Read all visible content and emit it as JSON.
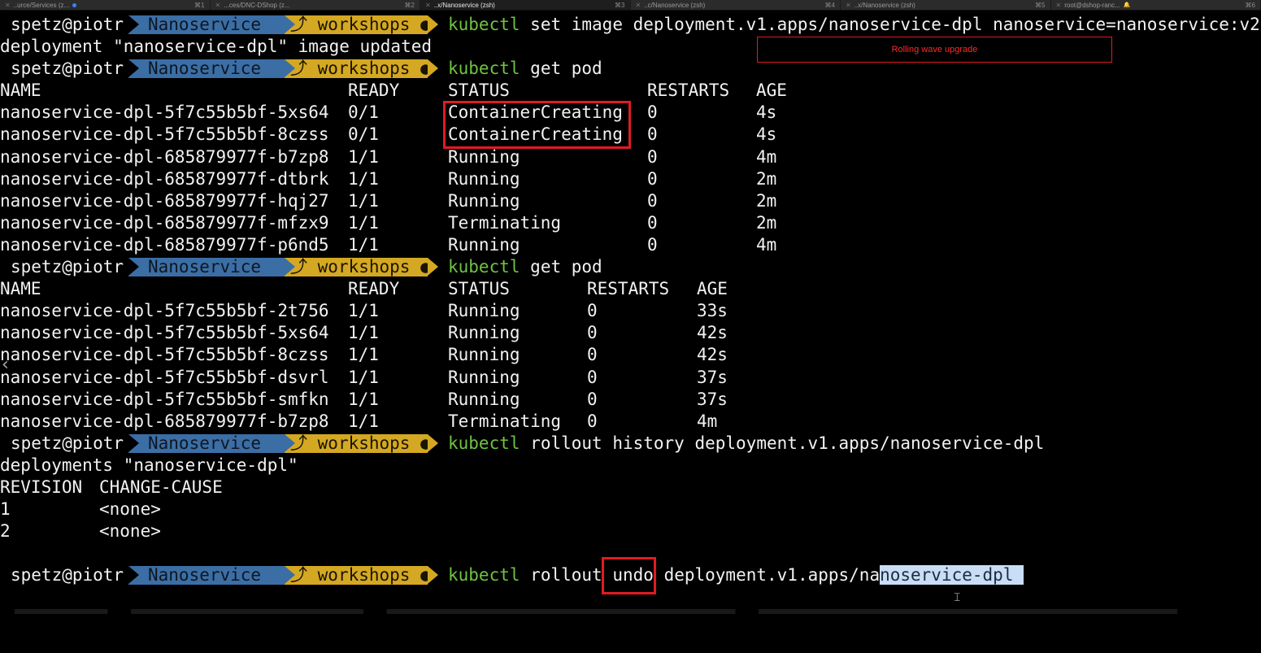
{
  "tabs": [
    {
      "label": "..urce/Services (z...",
      "shortcut": "⌘1",
      "dot": true,
      "active": false
    },
    {
      "label": "...ces/DNC-DShop (z...",
      "shortcut": "⌘2",
      "active": false
    },
    {
      "label": "..x/Nanoservice (zsh)",
      "shortcut": "⌘3",
      "active": true
    },
    {
      "label": "..c/Nanoservice (zsh)",
      "shortcut": "⌘4",
      "active": false
    },
    {
      "label": "..x/Nanoservice (zsh)",
      "shortcut": "⌘5",
      "active": false
    },
    {
      "label": "root@dshop-ranc...",
      "shortcut": "⌘6",
      "bell": true,
      "active": false
    }
  ],
  "prompt": {
    "user": "spetz@piotr",
    "dir": "Nanoservice",
    "branch_icon": "branch-icon",
    "branch_symbol": "⤴",
    "branch": "workshops",
    "dirty_marker": "●"
  },
  "commands": {
    "c1_kw": "kubectl",
    "c1_rest": "set image deployment.v1.apps/nanoservice-dpl nanoservice=nanoservice:v2",
    "c1_output": "deployment \"nanoservice-dpl\" image updated",
    "c2_kw": "kubectl",
    "c2_rest": "get pod",
    "c3_kw": "kubectl",
    "c3_rest": "get pod",
    "c4_kw": "kubectl",
    "c4_rest": "rollout history deployment.v1.apps/nanoservice-dpl",
    "c4_output": "deployments \"nanoservice-dpl\"",
    "c5_kw": "kubectl",
    "c5_a": "rollout",
    "c5_undo": "undo",
    "c5_b": "deployment.v1.apps/na",
    "c5_sel": "noservice-dpl "
  },
  "table1": {
    "headers": [
      "NAME",
      "READY",
      "STATUS",
      "RESTARTS",
      "AGE"
    ],
    "rows": [
      [
        "nanoservice-dpl-5f7c55b5bf-5xs64",
        "0/1",
        "ContainerCreating",
        "0",
        "4s"
      ],
      [
        "nanoservice-dpl-5f7c55b5bf-8czss",
        "0/1",
        "ContainerCreating",
        "0",
        "4s"
      ],
      [
        "nanoservice-dpl-685879977f-b7zp8",
        "1/1",
        "Running",
        "0",
        "4m"
      ],
      [
        "nanoservice-dpl-685879977f-dtbrk",
        "1/1",
        "Running",
        "0",
        "2m"
      ],
      [
        "nanoservice-dpl-685879977f-hqj27",
        "1/1",
        "Running",
        "0",
        "2m"
      ],
      [
        "nanoservice-dpl-685879977f-mfzx9",
        "1/1",
        "Terminating",
        "0",
        "2m"
      ],
      [
        "nanoservice-dpl-685879977f-p6nd5",
        "1/1",
        "Running",
        "0",
        "4m"
      ]
    ]
  },
  "table2": {
    "headers": [
      "NAME",
      "READY",
      "STATUS",
      "RESTARTS",
      "AGE"
    ],
    "rows": [
      [
        "nanoservice-dpl-5f7c55b5bf-2t756",
        "1/1",
        "Running",
        "0",
        "33s"
      ],
      [
        "nanoservice-dpl-5f7c55b5bf-5xs64",
        "1/1",
        "Running",
        "0",
        "42s"
      ],
      [
        "nanoservice-dpl-5f7c55b5bf-8czss",
        "1/1",
        "Running",
        "0",
        "42s"
      ],
      [
        "nanoservice-dpl-5f7c55b5bf-dsvrl",
        "1/1",
        "Running",
        "0",
        "37s"
      ],
      [
        "nanoservice-dpl-5f7c55b5bf-smfkn",
        "1/1",
        "Running",
        "0",
        "37s"
      ],
      [
        "nanoservice-dpl-685879977f-b7zp8",
        "1/1",
        "Terminating",
        "0",
        "4m"
      ]
    ]
  },
  "history": {
    "headers": [
      "REVISION",
      "CHANGE-CAUSE"
    ],
    "rows": [
      [
        "1",
        "<none>"
      ],
      [
        "2",
        "<none>"
      ]
    ]
  },
  "annotation": "Rolling wave upgrade",
  "colors": {
    "background": "#000000",
    "text": "#f2f2f2",
    "prompt_dir_bg": "#3b6ea5",
    "prompt_branch_bg": "#d4a822",
    "command_keyword": "#6ec341",
    "highlight_red": "#e01b24",
    "selection": "#c9ddf6"
  }
}
